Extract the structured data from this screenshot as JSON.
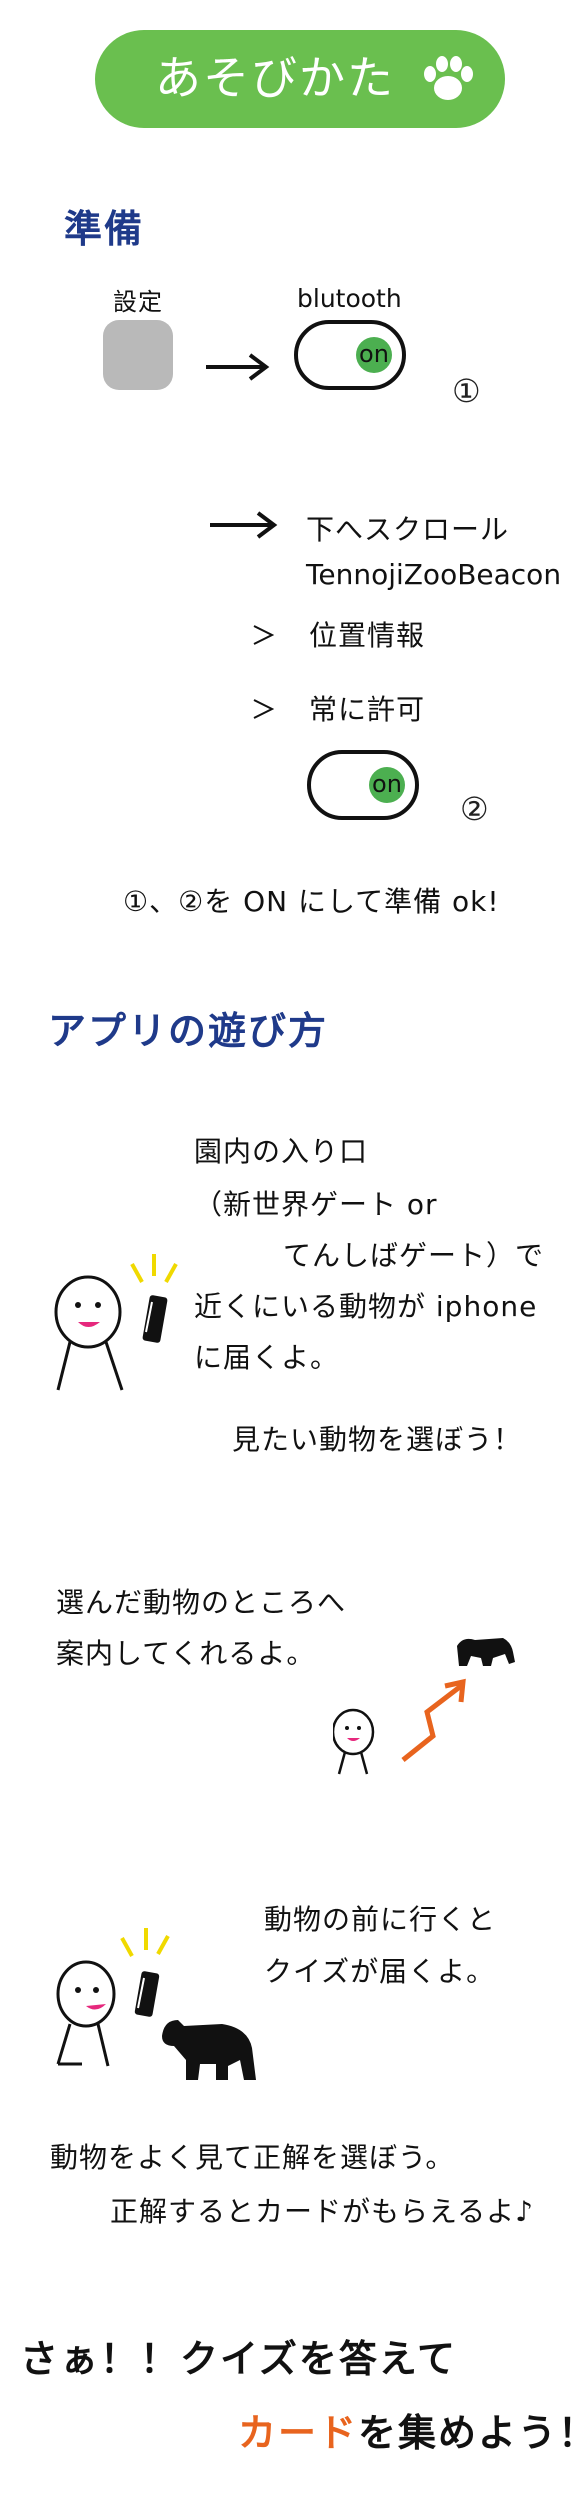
{
  "header": {
    "title": "あそびかた"
  },
  "prep": {
    "heading": "準備",
    "settings_label": "設定",
    "bluetooth_label": "blutooth",
    "toggle_on": "on",
    "marker1": "①",
    "scroll_down": "下へスクロール",
    "app_name": "TennojiZooBeacon",
    "location": "位置情報",
    "always_allow": "常に許可",
    "marker2": "②",
    "ready_text": "①、②を ON にして準備 ok!"
  },
  "howto": {
    "heading": "アプリの遊び方",
    "step1_lines": [
      "園内の入り口",
      "（新世界ゲート or",
      "てんしばゲート）で",
      "近くにいる動物が iphone",
      "に届くよ。"
    ],
    "choose_animal": "見たい動物を選ぼう！",
    "step2_lines": [
      "選んだ動物のところへ",
      "案内してくれるよ。"
    ],
    "step3_lines": [
      "動物の前に行くと",
      "クイズが届くよ。"
    ],
    "step4_line1": "動物をよく見て正解を選ぼう。",
    "step4_line2": "正解するとカードがもらえるよ♪"
  },
  "footer": {
    "line1": "さぁ！！クイズを答えて",
    "line2_highlight": "カード",
    "line2_rest": "を集めよう！"
  },
  "colors": {
    "accent_green": "#6abf4f",
    "heading_blue": "#1f3a8a",
    "highlight_orange": "#e8641e"
  }
}
